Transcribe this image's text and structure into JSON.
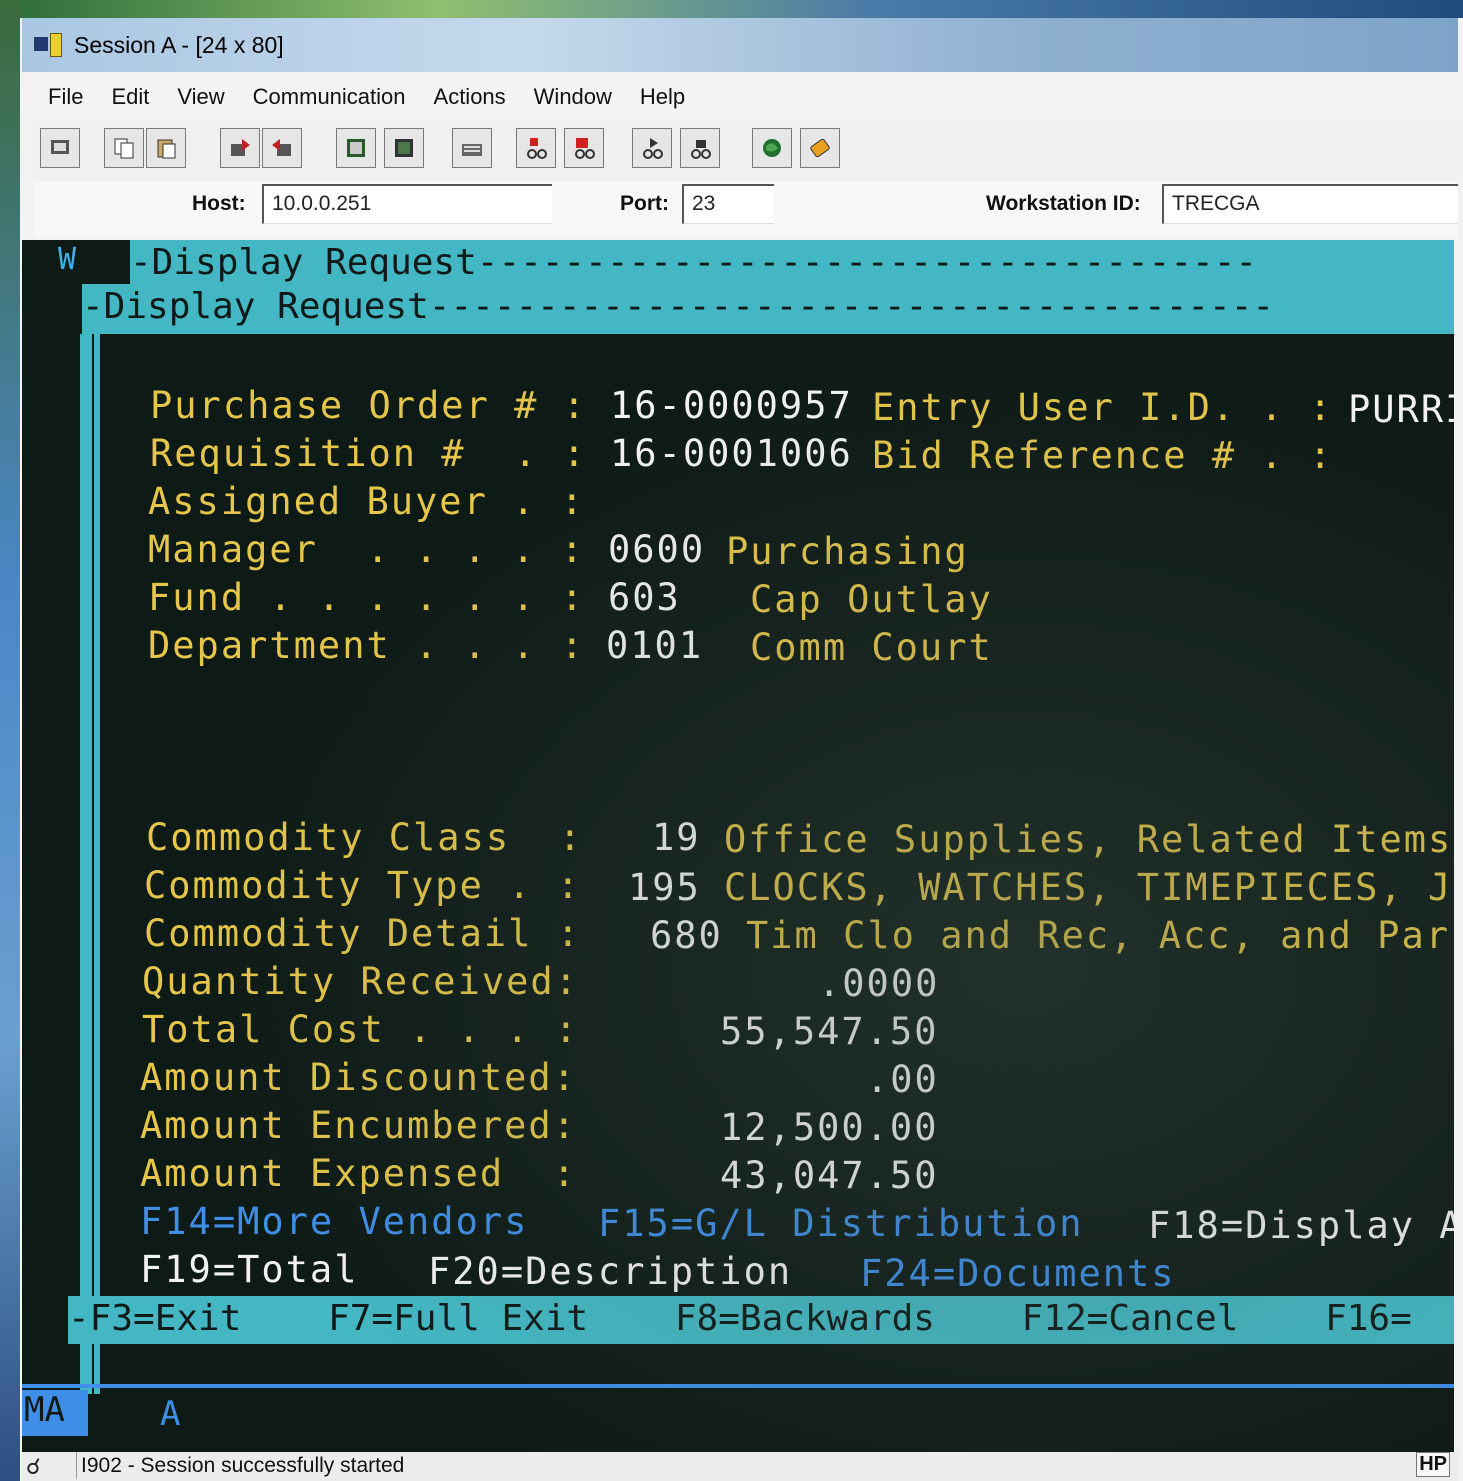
{
  "window": {
    "title": "Session A - [24 x 80]"
  },
  "menu": [
    "File",
    "Edit",
    "View",
    "Communication",
    "Actions",
    "Window",
    "Help"
  ],
  "toolbar_icons": [
    "display-icon",
    "copy-icon",
    "paste-icon",
    "send-icon",
    "receive-icon",
    "macro-icon",
    "macro2-icon",
    "keyboard-icon",
    "record-icon",
    "stop-icon",
    "play-icon",
    "play2-icon",
    "globe-icon",
    "key-icon"
  ],
  "connection": {
    "host_label": "Host:",
    "host_value": "10.0.0.251",
    "port_label": "Port:",
    "port_value": "23",
    "ws_label": "Workstation ID:",
    "ws_value": "TRECGA"
  },
  "terminal": {
    "window_marker": "W",
    "window_title_1": "-Display Request------------------------------------",
    "window_title_2": "-Display Request---------------------------------------",
    "fields": {
      "po_label": "Purchase Order # :",
      "po_value": "16-0000957",
      "entry_user_label": "Entry User I.D. . :",
      "entry_user_value": "PURRI",
      "req_label": "Requisition #  . :",
      "req_value": "16-0001006",
      "bid_label": "Bid Reference # . :",
      "buyer_label": "Assigned Buyer . :",
      "manager_label": "Manager  . . . . :",
      "manager_code": "0600",
      "manager_desc": "Purchasing",
      "fund_label": "Fund . . . . . . :",
      "fund_code": "603",
      "fund_desc": "Cap Outlay",
      "dept_label": "Department . . . :",
      "dept_code": "0101",
      "dept_desc": "Comm Court",
      "cclass_label": "Commodity Class  :",
      "cclass_code": "19",
      "cclass_desc": "Office Supplies, Related Items",
      "ctype_label": "Commodity Type . :",
      "ctype_code": "195",
      "ctype_desc": "CLOCKS, WATCHES, TIMEPIECES, JE",
      "cdetail_label": "Commodity Detail :",
      "cdetail_code": "680",
      "cdetail_desc": "Tim Clo and Rec, Acc, and Par",
      "qty_label": "Quantity Received:",
      "qty_value": ".0000",
      "cost_label": "Total Cost . . . :",
      "cost_value": "55,547.50",
      "disc_label": "Amount Discounted:",
      "disc_value": ".00",
      "enc_label": "Amount Encumbered:",
      "enc_value": "12,500.00",
      "exp_label": "Amount Expensed  :",
      "exp_value": "43,047.50"
    },
    "fkeys": {
      "f14": "F14=More Vendors",
      "f15": "F15=G/L Distribution",
      "f18": "F18=Display A",
      "f19": "F19=Total",
      "f20": "F20=Description",
      "f24": "F24=Documents"
    },
    "bottom_keys": "-F3=Exit    F7=Full Exit    F8=Backwards    F12=Cancel    F16=",
    "oia_ma": "MA",
    "oia_a": "A"
  },
  "status": {
    "message": "I902 - Session successfully started",
    "indicator": "HP"
  },
  "colors": {
    "terminal_bg": "#0e1a16",
    "field_label": "#e5c64a",
    "value": "#f2f2f2",
    "accent": "#43b8c4",
    "link": "#3f8fe8"
  }
}
